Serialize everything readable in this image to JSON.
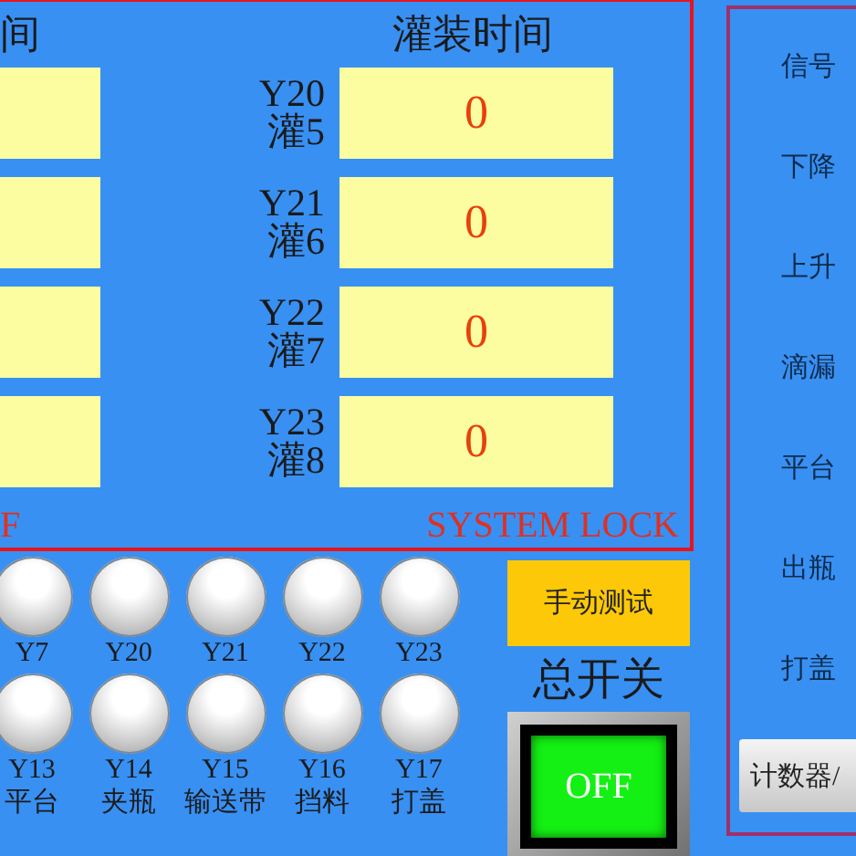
{
  "left_panel": {
    "title": "间",
    "fields": [
      {
        "kind": "input"
      },
      {
        "kind": "input"
      },
      {
        "kind": "input"
      },
      {
        "kind": "input"
      }
    ],
    "footer": "F"
  },
  "fill_panel": {
    "title": "灌装时间",
    "rows": [
      {
        "output": "Y20",
        "label": "灌5",
        "value": "0"
      },
      {
        "output": "Y21",
        "label": "灌6",
        "value": "0"
      },
      {
        "output": "Y22",
        "label": "灌7",
        "value": "0"
      },
      {
        "output": "Y23",
        "label": "灌8",
        "value": "0"
      }
    ],
    "footer": "SYSTEM LOCK"
  },
  "lamps": [
    [
      {
        "lines": [
          "Y7"
        ],
        "lit": false
      },
      {
        "lines": [
          "Y20"
        ],
        "lit": false
      },
      {
        "lines": [
          "Y21"
        ],
        "lit": false
      },
      {
        "lines": [
          "Y22"
        ],
        "lit": false
      },
      {
        "lines": [
          "Y23"
        ],
        "lit": false
      }
    ],
    [
      {
        "lines": [
          "Y13",
          "平台"
        ],
        "lit": false
      },
      {
        "lines": [
          "Y14",
          "夹瓶"
        ],
        "lit": false
      },
      {
        "lines": [
          "Y15",
          "输送带"
        ],
        "lit": false
      },
      {
        "lines": [
          "Y16",
          "挡料"
        ],
        "lit": false
      },
      {
        "lines": [
          "Y17",
          "打盖"
        ],
        "lit": false
      }
    ]
  ],
  "manual_test_button": "手动测试",
  "master_switch": {
    "title": "总开关",
    "label": "OFF",
    "on": false
  },
  "delay_panel": {
    "labels": [
      "信号",
      "下降",
      "上升",
      "滴漏",
      "平台",
      "出瓶",
      "打盖"
    ],
    "button": "计数器/"
  }
}
